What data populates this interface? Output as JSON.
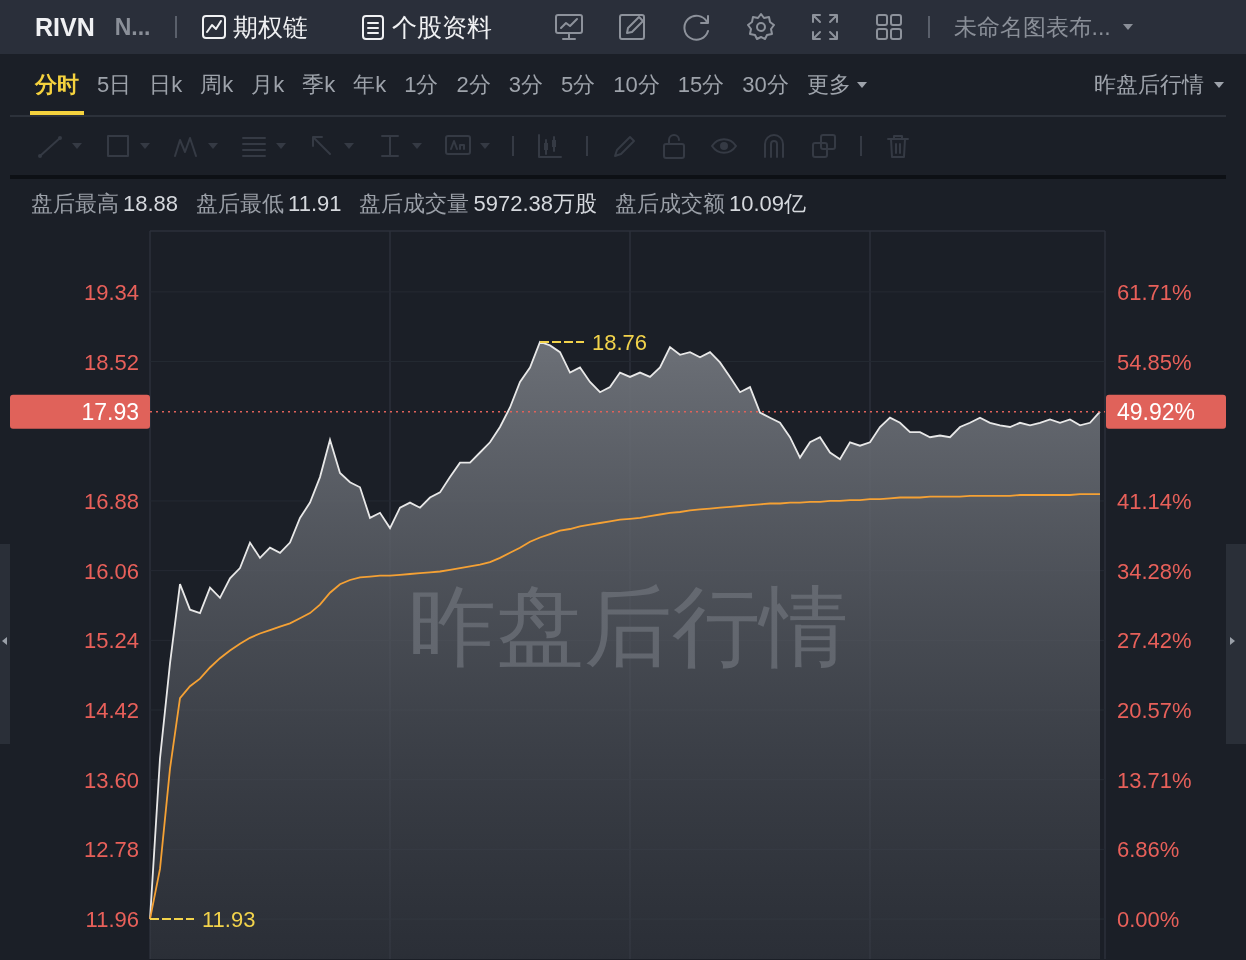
{
  "header": {
    "symbol": "RIVN",
    "name": "N...",
    "links": [
      {
        "kind": "options",
        "label": "期权链"
      },
      {
        "kind": "profile",
        "label": "个股资料"
      }
    ],
    "layout_menu": {
      "label": "未命名图表布..."
    }
  },
  "tabs": [
    {
      "label": "分时",
      "selected": true
    },
    {
      "label": "5日",
      "selected": false
    },
    {
      "label": "日k",
      "selected": false
    },
    {
      "label": "周k",
      "selected": false
    },
    {
      "label": "月k",
      "selected": false
    },
    {
      "label": "季k",
      "selected": false
    },
    {
      "label": "年k",
      "selected": false
    },
    {
      "label": "1分",
      "selected": false
    },
    {
      "label": "2分",
      "selected": false
    },
    {
      "label": "3分",
      "selected": false
    },
    {
      "label": "5分",
      "selected": false
    },
    {
      "label": "10分",
      "selected": false
    },
    {
      "label": "15分",
      "selected": false
    },
    {
      "label": "30分",
      "selected": false
    },
    {
      "label": "更多",
      "selected": false
    }
  ],
  "session_menu": {
    "label": "昨盘后行情"
  },
  "drawing_tools": [
    {
      "disabled": true
    },
    {
      "disabled": true
    },
    {
      "disabled": true
    },
    {
      "disabled": true
    },
    {
      "disabled": true
    },
    {
      "disabled": true
    },
    {
      "disabled": true
    },
    {
      "disabled": true
    },
    {
      "disabled": true
    },
    {
      "disabled": true
    },
    {
      "disabled": true
    },
    {
      "disabled": true
    },
    {
      "disabled": true
    },
    {
      "disabled": true
    }
  ],
  "stats": [
    {
      "label": "盘后最高",
      "value": "18.88"
    },
    {
      "label": "盘后最低",
      "value": "11.91"
    },
    {
      "label": "盘后成交量",
      "value": "5972.38万股"
    },
    {
      "label": "盘后成交额",
      "value": "10.09亿"
    }
  ],
  "chart": {
    "watermark": "昨盘后行情",
    "last_price": {
      "value": "17.93",
      "percent": "49.92%"
    },
    "right_ticks": [
      "61.71%",
      "54.85%",
      "41.14%",
      "34.28%",
      "27.42%",
      "20.57%",
      "13.71%",
      "6.86%",
      "0.00%"
    ],
    "chart_data": {
      "type": "area",
      "ylim": [
        11.49,
        20.08
      ],
      "yticks": [
        11.96,
        12.78,
        {
          "value": 13.6,
          "label": "13.60"
        },
        14.42,
        15.24,
        16.06,
        16.88,
        18.52,
        19.34
      ],
      "grid": true,
      "annotations": [
        "18.76",
        "11.93"
      ],
      "series": [
        {
          "type": "area",
          "color": "#e8e8e8",
          "values": [
            11.96,
            13.85,
            14.97,
            15.9,
            15.6,
            15.56,
            15.86,
            15.74,
            15.97,
            16.09,
            16.39,
            16.21,
            16.33,
            16.27,
            16.39,
            16.68,
            16.86,
            17.16,
            17.6,
            17.21,
            17.1,
            17.04,
            16.68,
            16.74,
            16.56,
            16.8,
            16.86,
            16.8,
            16.92,
            16.98,
            17.16,
            17.33,
            17.33,
            17.45,
            17.57,
            17.75,
            17.98,
            18.28,
            18.45,
            18.75,
            18.71,
            18.63,
            18.39,
            18.45,
            18.28,
            18.16,
            18.22,
            18.39,
            18.34,
            18.39,
            18.34,
            18.45,
            18.69,
            18.6,
            18.63,
            18.57,
            18.63,
            18.51,
            18.34,
            18.16,
            18.22,
            17.92,
            17.86,
            17.8,
            17.63,
            17.39,
            17.57,
            17.63,
            17.45,
            17.37,
            17.57,
            17.53,
            17.57,
            17.75,
            17.86,
            17.8,
            17.69,
            17.69,
            17.63,
            17.65,
            17.63,
            17.75,
            17.8,
            17.86,
            17.8,
            17.77,
            17.75,
            17.8,
            17.77,
            17.8,
            17.84,
            17.8,
            17.84,
            17.77,
            17.8,
            17.93
          ]
        },
        {
          "type": "line",
          "color": "#f5a134",
          "values": [
            11.96,
            12.55,
            13.73,
            14.56,
            14.7,
            14.79,
            14.92,
            15.03,
            15.12,
            15.2,
            15.27,
            15.32,
            15.36,
            15.4,
            15.44,
            15.5,
            15.56,
            15.66,
            15.8,
            15.9,
            15.95,
            15.98,
            15.99,
            16.0,
            16.0,
            16.01,
            16.02,
            16.03,
            16.04,
            16.05,
            16.07,
            16.09,
            16.11,
            16.13,
            16.16,
            16.21,
            16.27,
            16.33,
            16.4,
            16.45,
            16.49,
            16.53,
            16.55,
            16.58,
            16.6,
            16.62,
            16.64,
            16.66,
            16.67,
            16.68,
            16.7,
            16.72,
            16.74,
            16.75,
            16.77,
            16.78,
            16.79,
            16.8,
            16.81,
            16.82,
            16.83,
            16.84,
            16.85,
            16.85,
            16.86,
            16.86,
            16.87,
            16.87,
            16.88,
            16.88,
            16.89,
            16.89,
            16.9,
            16.9,
            16.91,
            16.92,
            16.92,
            16.92,
            16.93,
            16.93,
            16.93,
            16.93,
            16.94,
            16.94,
            16.94,
            16.94,
            16.94,
            16.95,
            16.95,
            16.95,
            16.95,
            16.95,
            16.95,
            16.96,
            16.96,
            16.96
          ]
        }
      ]
    }
  }
}
